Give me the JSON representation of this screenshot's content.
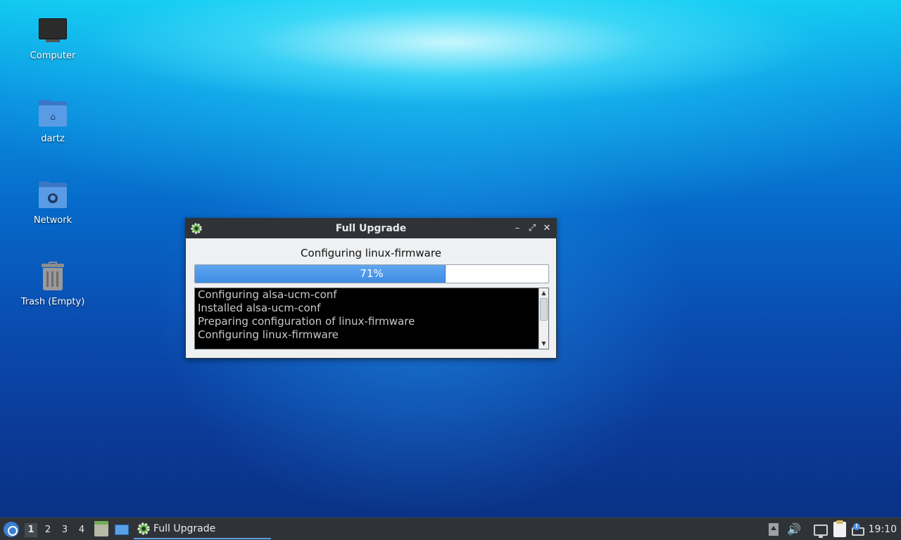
{
  "desktop": {
    "icons": [
      {
        "label": "Computer",
        "icon": "computer-icon"
      },
      {
        "label": "dartz",
        "icon": "home-folder-icon"
      },
      {
        "label": "Network",
        "icon": "network-folder-icon"
      },
      {
        "label": "Trash (Empty)",
        "icon": "trash-icon"
      }
    ]
  },
  "dialog": {
    "title": "Full Upgrade",
    "app_icon": "gear-icon",
    "buttons": {
      "minimize": "–",
      "maximize": "⤢",
      "close": "✕"
    },
    "status": "Configuring linux-firmware",
    "progress": {
      "value": 0.71,
      "label": "71%"
    },
    "log_lines": [
      "Configuring alsa-ucm-conf",
      "Installed alsa-ucm-conf",
      "Preparing configuration of linux-firmware",
      "Configuring linux-firmware"
    ]
  },
  "taskbar": {
    "workspaces": [
      "1",
      "2",
      "3",
      "4"
    ],
    "active_workspace": "1",
    "task_label": "Full Upgrade",
    "clock": "19:10",
    "tray_icons": [
      "tray-up-arrow-icon",
      "volume-icon",
      "network-icon",
      "clipboard-icon",
      "update-notifier-icon"
    ]
  }
}
